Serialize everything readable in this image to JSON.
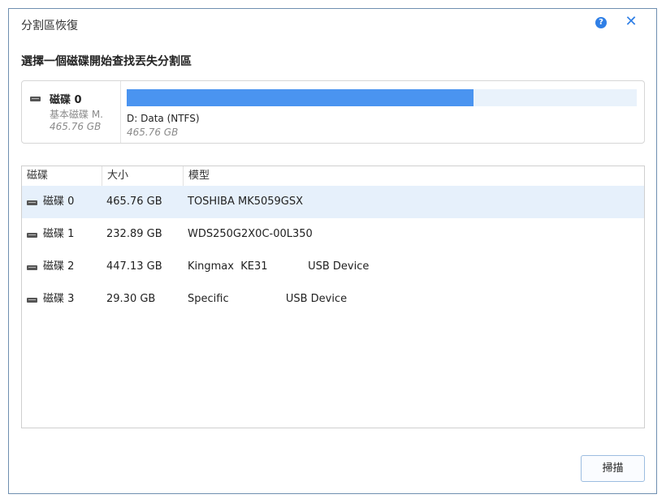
{
  "window": {
    "title": "分割區恢復"
  },
  "instruction": "選擇一個磁碟開始查找丟失分割區",
  "selected_disk": {
    "name": "磁碟 0",
    "type": "基本磁碟 M.",
    "size": "465.76 GB",
    "partition": {
      "label": "D: Data (NTFS)",
      "size": "465.76 GB",
      "used_fraction": 0.68
    }
  },
  "table": {
    "headers": [
      "磁碟",
      "大小",
      "模型"
    ],
    "rows": [
      {
        "disk": "磁碟 0",
        "size": "465.76 GB",
        "model": "TOSHIBA MK5059GSX",
        "selected": true
      },
      {
        "disk": "磁碟 1",
        "size": "232.89 GB",
        "model": "WDS250G2X0C-00L350",
        "selected": false
      },
      {
        "disk": "磁碟 2",
        "size": "447.13 GB",
        "model": "Kingmax  KE31            USB Device",
        "selected": false
      },
      {
        "disk": "磁碟 3",
        "size": "29.30 GB",
        "model": "Specific                 USB Device",
        "selected": false
      }
    ]
  },
  "buttons": {
    "scan": "掃描"
  },
  "colors": {
    "accent": "#2f7fe6",
    "bar_fill": "#4a94f0",
    "bar_track": "#e9f2fb",
    "selected_row": "#e6f0fb"
  },
  "icons": {
    "help": "help-icon",
    "close": "close-icon",
    "drive": "drive-icon"
  }
}
